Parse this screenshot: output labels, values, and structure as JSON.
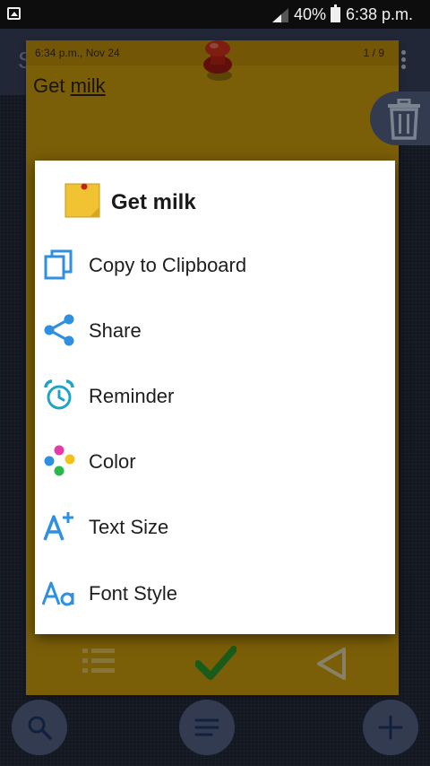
{
  "status_bar": {
    "battery_percent": "40%",
    "time": "6:38 p.m."
  },
  "background_app": {
    "title": "S"
  },
  "note": {
    "date": "6:34 p.m., Nov 24",
    "page": "1 / 9",
    "text_prefix": "Get ",
    "text_underlined": "milk",
    "color": "#d2a20f"
  },
  "dialog": {
    "title": "Get milk",
    "items": [
      {
        "label": "Copy to Clipboard",
        "icon": "copy-icon"
      },
      {
        "label": "Share",
        "icon": "share-icon"
      },
      {
        "label": "Reminder",
        "icon": "alarm-clock-icon"
      },
      {
        "label": "Color",
        "icon": "color-dots-icon"
      },
      {
        "label": "Text Size",
        "icon": "text-size-icon"
      },
      {
        "label": "Font Style",
        "icon": "font-style-icon"
      }
    ]
  },
  "colors": {
    "accent_blue": "#2f8fe0",
    "fab": "#58678c",
    "check_green": "#2e9e2e"
  }
}
